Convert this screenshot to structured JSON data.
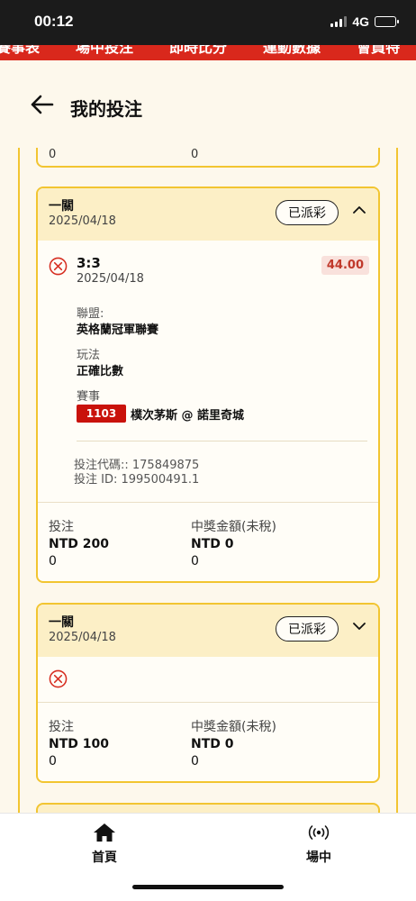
{
  "status_bar": {
    "time": "00:12",
    "network": "4G"
  },
  "top_nav": {
    "items": [
      "賽事表",
      "場中投注",
      "即時比分",
      "運動數據",
      "會員特"
    ]
  },
  "header": {
    "title": "我的投注"
  },
  "prev_card": {
    "left_value": "0",
    "right_value": "0"
  },
  "cards": [
    {
      "type": "一關",
      "date": "2025/04/18",
      "status": "已派彩",
      "expanded": true,
      "selection": {
        "result_icon": "cross-circle-icon",
        "score": "3:3",
        "date": "2025/04/18",
        "odds": "44.00",
        "league_label": "聯盟:",
        "league_value": "英格蘭冠軍聯賽",
        "market_label": "玩法",
        "market_value": "正確比數",
        "event_label": "賽事",
        "event_number": "1103",
        "event_name": "樸次茅斯 @ 諾里奇城",
        "bet_code": "投注代碼:: 175849875",
        "bet_id": "投注 ID: 199500491.1"
      },
      "footer": {
        "stake_label": "投注",
        "stake_amount": "NTD 200",
        "stake_sub": "0",
        "payout_label": "中獎金額(未稅)",
        "payout_amount": "NTD 0",
        "payout_sub": "0"
      }
    },
    {
      "type": "一關",
      "date": "2025/04/18",
      "status": "已派彩",
      "expanded": false,
      "selection": {
        "result_icon": "cross-circle-icon"
      },
      "footer": {
        "stake_label": "投注",
        "stake_amount": "NTD 100",
        "stake_sub": "0",
        "payout_label": "中獎金額(未稅)",
        "payout_amount": "NTD 0",
        "payout_sub": "0"
      }
    }
  ],
  "bottom_nav": {
    "items": [
      {
        "label": "首頁",
        "icon": "home-icon"
      },
      {
        "label": "場中",
        "icon": "live-broadcast-icon"
      }
    ]
  },
  "colors": {
    "accent_border": "#f2c531",
    "top_nav_bg": "#d9281c",
    "odds_text": "#c0392b",
    "event_badge_bg": "#c9120b",
    "loss_icon": "#d62d20"
  }
}
